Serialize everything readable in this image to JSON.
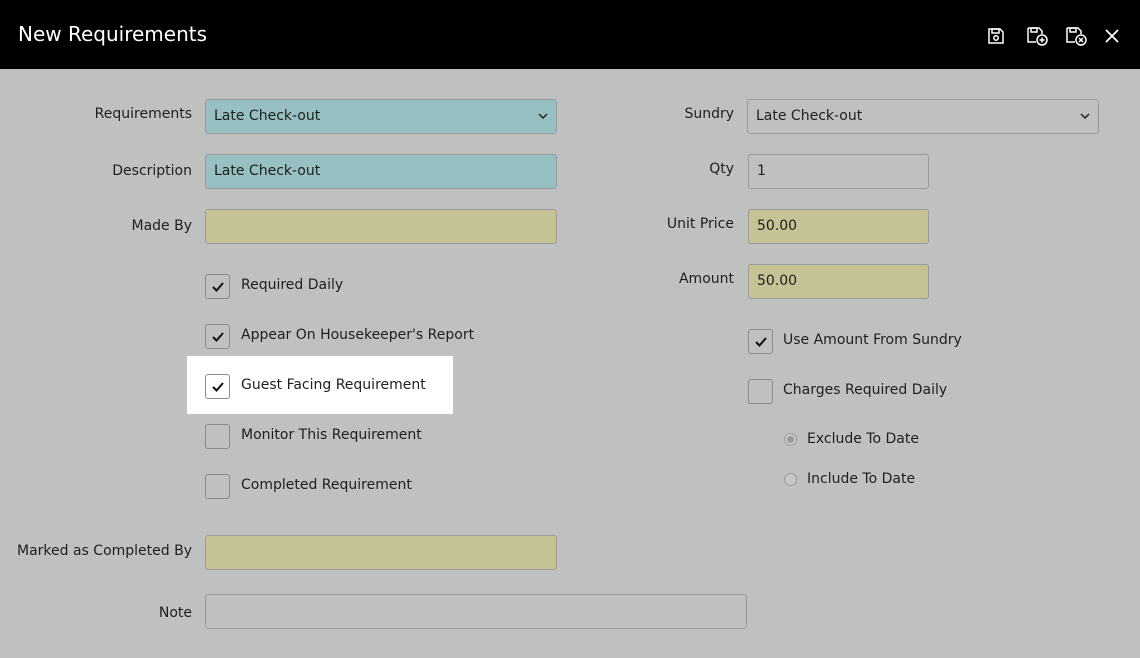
{
  "header": {
    "title": "New Requirements",
    "icons": [
      "save-icon",
      "save-and-new-icon",
      "save-and-close-icon",
      "close-icon"
    ]
  },
  "left": {
    "requirements": {
      "label": "Requirements",
      "value": "Late Check-out"
    },
    "description": {
      "label": "Description",
      "value": "Late Check-out"
    },
    "made_by": {
      "label": "Made By",
      "value": ""
    },
    "checkboxes": [
      {
        "label": "Required Daily",
        "checked": true
      },
      {
        "label": "Appear On Housekeeper's Report",
        "checked": true
      },
      {
        "label": "Guest Facing Requirement",
        "checked": true
      },
      {
        "label": "Monitor This Requirement",
        "checked": false
      },
      {
        "label": "Completed Requirement",
        "checked": false
      }
    ],
    "marked_completed_by": {
      "label": "Marked as Completed By",
      "value": ""
    },
    "note": {
      "label": "Note",
      "value": ""
    }
  },
  "right": {
    "sundry": {
      "label": "Sundry",
      "value": "Late Check-out"
    },
    "qty": {
      "label": "Qty",
      "value": "1"
    },
    "unit_price": {
      "label": "Unit Price",
      "value": "50.00"
    },
    "amount": {
      "label": "Amount",
      "value": "50.00"
    },
    "use_amount_from_sundry": {
      "label": "Use Amount From Sundry",
      "checked": true
    },
    "charges_required_daily": {
      "label": "Charges Required Daily",
      "checked": false
    },
    "radios": [
      {
        "label": "Exclude To Date",
        "selected": true
      },
      {
        "label": "Include To Date",
        "selected": false
      }
    ]
  },
  "colors": {
    "header_bg": "#000000",
    "body_bg": "#c0c0c0",
    "teal_field": "#96c0c2",
    "khaki_field": "#c5c293"
  }
}
